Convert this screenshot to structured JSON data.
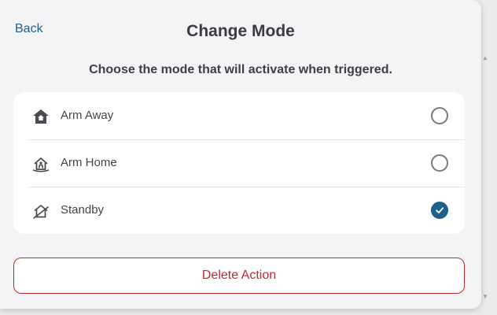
{
  "header": {
    "back_label": "Back",
    "title": "Change Mode"
  },
  "instructions": "Choose the mode that will activate when triggered.",
  "modes": [
    {
      "label": "Arm Away",
      "icon": "arm-away-icon",
      "selected": false
    },
    {
      "label": "Arm Home",
      "icon": "arm-home-icon",
      "selected": false
    },
    {
      "label": "Standby",
      "icon": "standby-icon",
      "selected": true
    }
  ],
  "delete_label": "Delete Action",
  "colors": {
    "accent": "#1f5f8b",
    "danger": "#c0282f",
    "background": "#f4f4f6"
  }
}
